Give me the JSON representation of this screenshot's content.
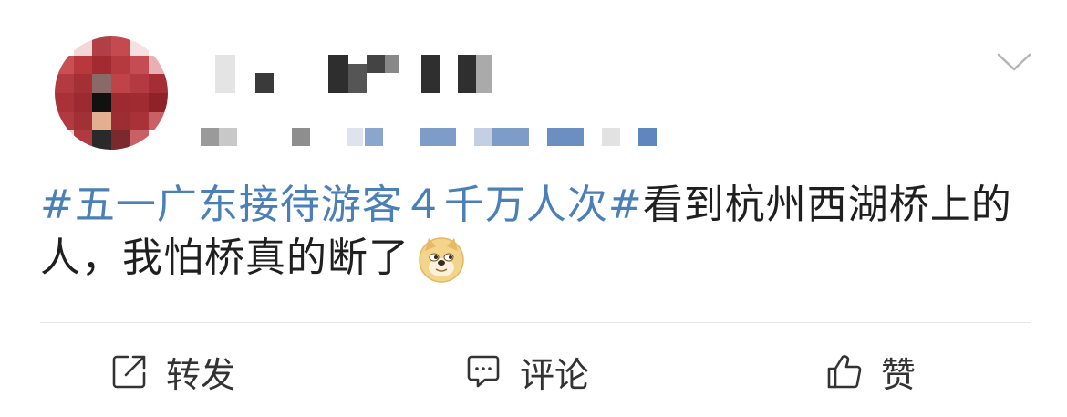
{
  "post": {
    "topic": "#五一广东接待游客４千万人次#",
    "text": "看到杭州西湖桥上的人，我怕桥真的断了"
  },
  "actions": {
    "repost_label": "转发",
    "comment_label": "评论",
    "like_label": "赞"
  },
  "icons": {
    "menu": "chevron-down-icon",
    "emoji": "doge-emoji-icon",
    "repost": "share-box-icon",
    "comment": "chat-bubble-icon",
    "like": "thumbs-up-icon"
  },
  "colors": {
    "topic": "#4a7fb8",
    "text": "#1f1f1f",
    "action_text": "#333333",
    "divider": "#e6e6e6"
  }
}
